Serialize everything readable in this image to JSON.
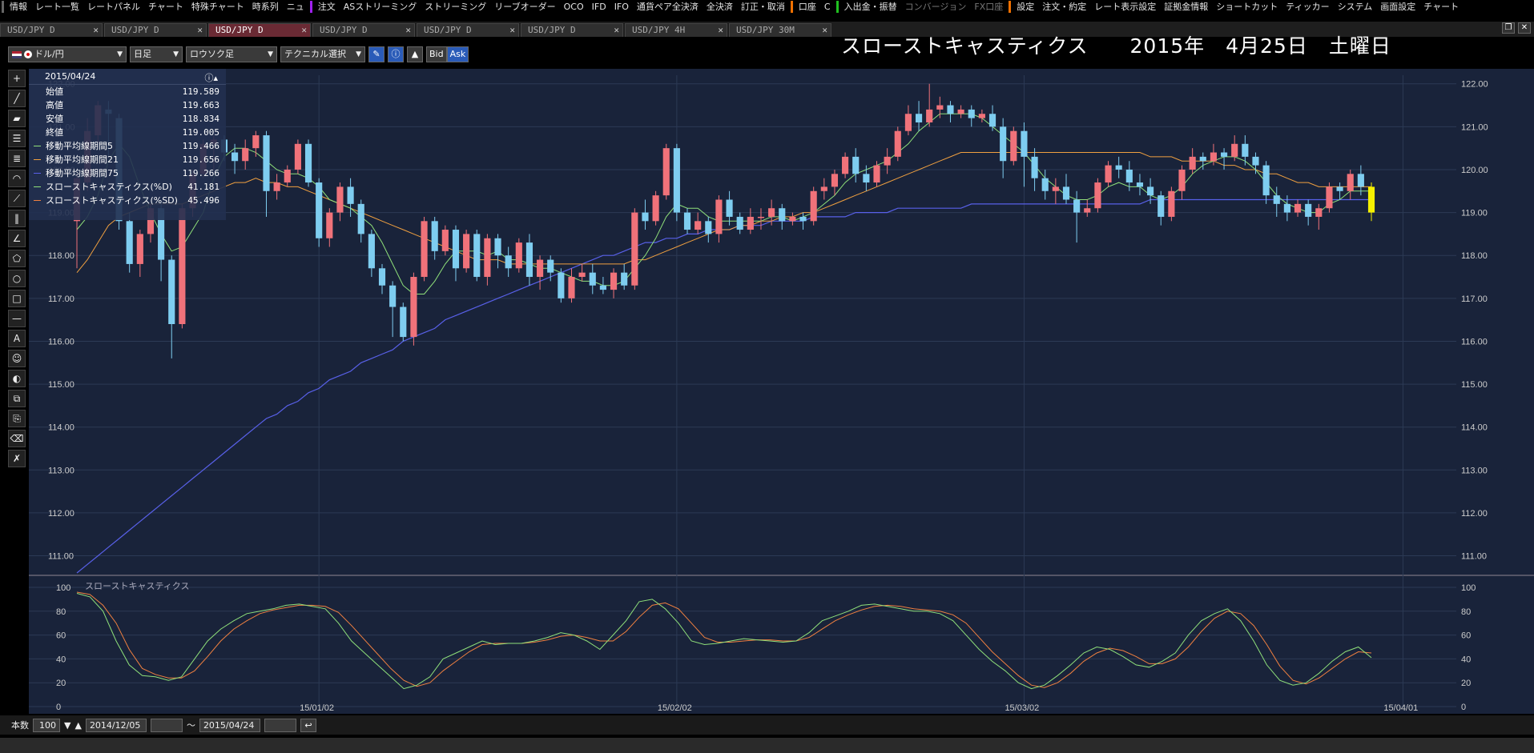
{
  "menubar": {
    "items": [
      "情報",
      "レート一覧",
      "レートパネル",
      "チャート",
      "特殊チャート",
      "時系列",
      "ニュ"
    ],
    "items2": [
      "注文",
      "ASストリーミング",
      "ストリーミング",
      "リーブオーダー",
      "OCO",
      "IFD",
      "IFO",
      "通貨ペア全決済",
      "全決済",
      "訂正・取消"
    ],
    "items3": [
      "口座",
      "C"
    ],
    "items4": [
      "入出金・振替"
    ],
    "items5": [
      "コンバージョン",
      "FX口座"
    ],
    "items6": [
      "設定",
      "注文・約定",
      "レート表示設定",
      "証拠金情報",
      "ショートカット",
      "ティッカー",
      "システム",
      "画面設定",
      "チャート"
    ]
  },
  "tabs": [
    {
      "label": "USD/JPY D",
      "active": false
    },
    {
      "label": "USD/JPY D",
      "active": false
    },
    {
      "label": "USD/JPY D",
      "active": true
    },
    {
      "label": "USD/JPY D",
      "active": false
    },
    {
      "label": "USD/JPY D",
      "active": false
    },
    {
      "label": "USD/JPY D",
      "active": false
    },
    {
      "label": "USD/JPY 4H",
      "active": false
    },
    {
      "label": "USD/JPY 30M",
      "active": false
    }
  ],
  "toolbar": {
    "pair": "ドル/円",
    "timeframe": "日足",
    "chart_type": "ロウソク足",
    "technical": "テクニカル選択",
    "bid": "Bid",
    "ask": "Ask"
  },
  "title": "スローストキャスティクス　　2015年　4月25日　土曜日",
  "info": {
    "date": "2015/04/24",
    "rows": [
      {
        "label": "始値",
        "value": "119.589"
      },
      {
        "label": "高値",
        "value": "119.663"
      },
      {
        "label": "安値",
        "value": "118.834"
      },
      {
        "label": "終値",
        "value": "119.005"
      },
      {
        "label": "移動平均線期間5",
        "value": "119.466"
      },
      {
        "label": "移動平均線期間21",
        "value": "119.656"
      },
      {
        "label": "移動平均線期間75",
        "value": "119.266"
      },
      {
        "label": "スローストキャスティクス(%D)",
        "value": "41.181"
      },
      {
        "label": "スローストキャスティクス(%SD)",
        "value": "45.496"
      }
    ]
  },
  "colors": {
    "up": "#f0727a",
    "down": "#7ecdf0",
    "ma5": "#8fe07a",
    "ma21": "#f0a040",
    "ma75": "#5860e8",
    "pct_d": "#8fe07a",
    "pct_sd": "#f08040",
    "last": "#f5f000"
  },
  "chart_data": {
    "type": "candlestick",
    "price_axis": {
      "ticks": [
        "122.00",
        "121.00",
        "120.00",
        "119.00",
        "118.00",
        "117.00",
        "116.00",
        "115.00",
        "114.00",
        "113.00",
        "112.00",
        "111.00"
      ],
      "ylim": [
        110.6,
        122.2
      ]
    },
    "date_labels": [
      "15/01/02",
      "15/02/02",
      "15/03/02",
      "15/04/01"
    ],
    "stoch_label": "スローストキャスティクス",
    "stoch_axis": {
      "ticks": [
        "100",
        "80",
        "60",
        "40",
        "20",
        "0"
      ],
      "ylim": [
        0,
        100
      ]
    },
    "candles": [
      [
        118.8,
        119.8,
        117.7,
        119.9
      ],
      [
        119.7,
        120.9,
        119.5,
        121.2
      ],
      [
        120.8,
        121.5,
        120.6,
        121.6
      ],
      [
        121.4,
        121.3,
        120.3,
        121.6
      ],
      [
        121.2,
        118.8,
        118.6,
        121.3
      ],
      [
        118.8,
        117.8,
        117.6,
        119.0
      ],
      [
        117.8,
        118.5,
        117.5,
        118.6
      ],
      [
        118.5,
        119.1,
        118.3,
        119.2
      ],
      [
        119.1,
        117.9,
        117.4,
        119.3
      ],
      [
        117.9,
        116.4,
        115.6,
        118.0
      ],
      [
        116.4,
        119.1,
        116.3,
        119.2
      ],
      [
        119.1,
        119.9,
        118.9,
        120.0
      ],
      [
        119.9,
        120.6,
        119.8,
        120.7
      ],
      [
        120.6,
        120.7,
        120.0,
        120.8
      ],
      [
        120.7,
        120.4,
        120.2,
        120.8
      ],
      [
        120.4,
        120.2,
        119.9,
        120.6
      ],
      [
        120.2,
        120.5,
        120.0,
        120.7
      ],
      [
        120.5,
        120.8,
        120.3,
        120.9
      ],
      [
        120.8,
        119.5,
        118.9,
        120.9
      ],
      [
        119.5,
        119.7,
        119.3,
        119.9
      ],
      [
        119.7,
        120.0,
        119.6,
        120.1
      ],
      [
        120.0,
        120.6,
        119.9,
        120.7
      ],
      [
        120.6,
        119.7,
        119.6,
        120.7
      ],
      [
        119.7,
        118.4,
        118.2,
        119.8
      ],
      [
        118.4,
        119.0,
        118.2,
        119.1
      ],
      [
        119.0,
        119.6,
        118.8,
        119.7
      ],
      [
        119.6,
        119.2,
        118.9,
        119.8
      ],
      [
        119.2,
        118.5,
        118.3,
        119.3
      ],
      [
        118.5,
        117.7,
        117.5,
        118.6
      ],
      [
        117.7,
        117.3,
        117.1,
        117.8
      ],
      [
        117.3,
        116.8,
        116.1,
        117.4
      ],
      [
        116.8,
        116.1,
        116.0,
        116.9
      ],
      [
        116.1,
        117.5,
        115.9,
        117.6
      ],
      [
        117.5,
        118.8,
        117.4,
        118.9
      ],
      [
        118.8,
        118.1,
        117.9,
        118.9
      ],
      [
        118.1,
        118.6,
        118.0,
        118.7
      ],
      [
        118.6,
        117.7,
        117.4,
        118.7
      ],
      [
        117.7,
        118.5,
        117.6,
        118.6
      ],
      [
        118.5,
        117.5,
        117.4,
        118.6
      ],
      [
        117.5,
        118.4,
        117.3,
        118.5
      ],
      [
        118.4,
        118.0,
        117.7,
        118.5
      ],
      [
        118.0,
        117.7,
        117.5,
        118.2
      ],
      [
        117.7,
        118.3,
        117.6,
        118.4
      ],
      [
        118.3,
        117.5,
        117.3,
        118.5
      ],
      [
        117.5,
        117.9,
        117.2,
        118.0
      ],
      [
        117.9,
        117.6,
        117.4,
        118.0
      ],
      [
        117.6,
        117.0,
        116.9,
        117.7
      ],
      [
        117.0,
        117.5,
        116.9,
        117.7
      ],
      [
        117.5,
        117.6,
        117.4,
        117.8
      ],
      [
        117.6,
        117.3,
        117.1,
        117.8
      ],
      [
        117.3,
        117.2,
        117.1,
        117.5
      ],
      [
        117.2,
        117.6,
        117.0,
        117.7
      ],
      [
        117.6,
        117.3,
        117.2,
        117.8
      ],
      [
        117.3,
        119.0,
        117.2,
        119.1
      ],
      [
        119.0,
        118.8,
        118.6,
        119.3
      ],
      [
        118.8,
        119.4,
        118.7,
        119.5
      ],
      [
        119.4,
        120.5,
        119.3,
        120.6
      ],
      [
        120.5,
        119.0,
        118.8,
        120.6
      ],
      [
        119.0,
        118.6,
        118.5,
        119.1
      ],
      [
        118.6,
        118.8,
        118.5,
        119.0
      ],
      [
        118.8,
        118.5,
        118.3,
        118.9
      ],
      [
        118.5,
        119.3,
        118.3,
        119.4
      ],
      [
        119.3,
        118.9,
        118.7,
        119.5
      ],
      [
        118.9,
        118.6,
        118.5,
        119.0
      ],
      [
        118.6,
        118.9,
        118.5,
        119.1
      ],
      [
        118.9,
        118.9,
        118.6,
        119.1
      ],
      [
        118.9,
        119.1,
        118.7,
        119.3
      ],
      [
        119.1,
        118.8,
        118.6,
        119.2
      ],
      [
        118.8,
        118.9,
        118.7,
        119.0
      ],
      [
        118.9,
        118.8,
        118.6,
        119.0
      ],
      [
        118.8,
        119.5,
        118.7,
        119.6
      ],
      [
        119.5,
        119.6,
        119.3,
        119.8
      ],
      [
        119.6,
        119.9,
        119.4,
        120.0
      ],
      [
        119.9,
        120.3,
        119.8,
        120.4
      ],
      [
        120.3,
        119.9,
        119.7,
        120.5
      ],
      [
        119.9,
        119.7,
        119.5,
        120.1
      ],
      [
        119.7,
        120.1,
        119.6,
        120.2
      ],
      [
        120.1,
        120.3,
        119.9,
        120.5
      ],
      [
        120.3,
        120.9,
        120.2,
        121.0
      ],
      [
        120.9,
        121.3,
        120.8,
        121.5
      ],
      [
        121.3,
        121.1,
        120.9,
        121.6
      ],
      [
        121.1,
        121.4,
        121.0,
        122.0
      ],
      [
        121.4,
        121.5,
        121.2,
        121.7
      ],
      [
        121.5,
        121.3,
        121.1,
        121.6
      ],
      [
        121.3,
        121.4,
        121.2,
        121.5
      ],
      [
        121.4,
        121.2,
        121.0,
        121.5
      ],
      [
        121.2,
        121.3,
        121.1,
        121.4
      ],
      [
        121.3,
        121.0,
        120.9,
        121.5
      ],
      [
        121.0,
        120.2,
        119.8,
        121.2
      ],
      [
        120.2,
        120.9,
        120.1,
        121.0
      ],
      [
        120.9,
        120.3,
        119.6,
        121.1
      ],
      [
        120.3,
        119.8,
        119.5,
        120.5
      ],
      [
        119.8,
        119.5,
        119.3,
        120.0
      ],
      [
        119.5,
        119.6,
        119.2,
        119.8
      ],
      [
        119.6,
        119.3,
        119.2,
        119.9
      ],
      [
        119.3,
        119.0,
        118.3,
        119.5
      ],
      [
        119.0,
        119.1,
        118.9,
        119.3
      ],
      [
        119.1,
        119.7,
        119.0,
        119.8
      ],
      [
        119.7,
        120.1,
        119.6,
        120.2
      ],
      [
        120.1,
        120.0,
        119.8,
        120.3
      ],
      [
        120.0,
        119.7,
        119.5,
        120.2
      ],
      [
        119.7,
        119.6,
        119.4,
        119.9
      ],
      [
        119.6,
        119.4,
        119.2,
        119.8
      ],
      [
        119.4,
        118.9,
        118.7,
        119.5
      ],
      [
        118.9,
        119.5,
        118.8,
        119.6
      ],
      [
        119.5,
        120.0,
        119.3,
        120.1
      ],
      [
        120.0,
        120.3,
        119.9,
        120.5
      ],
      [
        120.3,
        120.2,
        120.0,
        120.4
      ],
      [
        120.2,
        120.4,
        120.1,
        120.6
      ],
      [
        120.4,
        120.3,
        120.0,
        120.5
      ],
      [
        120.3,
        120.6,
        120.2,
        120.8
      ],
      [
        120.6,
        120.3,
        120.1,
        120.8
      ],
      [
        120.3,
        120.1,
        119.9,
        120.4
      ],
      [
        120.1,
        119.4,
        119.2,
        120.2
      ],
      [
        119.4,
        119.2,
        118.9,
        119.6
      ],
      [
        119.2,
        119.0,
        118.8,
        119.4
      ],
      [
        119.0,
        119.2,
        118.9,
        119.3
      ],
      [
        119.2,
        118.9,
        118.7,
        119.3
      ],
      [
        118.9,
        119.1,
        118.6,
        119.2
      ],
      [
        119.1,
        119.6,
        119.0,
        119.7
      ],
      [
        119.6,
        119.5,
        119.3,
        119.7
      ],
      [
        119.5,
        119.9,
        119.3,
        120.0
      ],
      [
        119.9,
        119.6,
        119.4,
        120.1
      ],
      [
        119.6,
        119.0,
        118.8,
        119.7
      ]
    ],
    "ma5": [
      118.6,
      118.9,
      119.4,
      120.2,
      120.6,
      120.3,
      119.6,
      119.0,
      118.5,
      118.1,
      118.2,
      118.6,
      119.0,
      119.8,
      120.3,
      120.5,
      120.5,
      120.4,
      120.2,
      120.0,
      119.9,
      119.9,
      119.8,
      119.6,
      119.3,
      119.2,
      119.1,
      118.9,
      118.7,
      118.3,
      117.8,
      117.3,
      117.1,
      117.1,
      117.4,
      117.8,
      118.1,
      118.1,
      118.1,
      118.0,
      118.1,
      117.9,
      117.9,
      117.8,
      117.7,
      117.7,
      117.6,
      117.5,
      117.4,
      117.4,
      117.3,
      117.3,
      117.4,
      117.7,
      118.0,
      118.4,
      118.9,
      119.2,
      119.1,
      119.1,
      118.9,
      118.8,
      118.8,
      118.8,
      118.8,
      118.8,
      118.9,
      118.9,
      118.8,
      118.9,
      119.0,
      119.2,
      119.4,
      119.7,
      119.9,
      120.0,
      120.1,
      120.2,
      120.4,
      120.6,
      120.9,
      121.1,
      121.3,
      121.3,
      121.3,
      121.3,
      121.2,
      121.0,
      120.8,
      120.6,
      120.4,
      120.1,
      119.8,
      119.6,
      119.4,
      119.3,
      119.3,
      119.4,
      119.6,
      119.7,
      119.6,
      119.6,
      119.4,
      119.3,
      119.4,
      119.6,
      119.9,
      120.1,
      120.2,
      120.3,
      120.3,
      120.2,
      120.0,
      119.7,
      119.4,
      119.2,
      119.1,
      119.0,
      119.0,
      119.2,
      119.3,
      119.5,
      119.5,
      119.5
    ],
    "ma21": [
      117.6,
      117.9,
      118.3,
      118.7,
      118.9,
      119.0,
      119.1,
      119.2,
      119.2,
      119.2,
      119.2,
      119.3,
      119.4,
      119.5,
      119.6,
      119.7,
      119.7,
      119.8,
      119.7,
      119.7,
      119.6,
      119.6,
      119.5,
      119.4,
      119.3,
      119.2,
      119.1,
      119.0,
      118.9,
      118.8,
      118.7,
      118.6,
      118.5,
      118.4,
      118.3,
      118.2,
      118.1,
      118.0,
      117.9,
      117.9,
      117.9,
      117.8,
      117.8,
      117.8,
      117.8,
      117.8,
      117.8,
      117.8,
      117.8,
      117.8,
      117.8,
      117.8,
      117.8,
      117.9,
      117.9,
      118.0,
      118.1,
      118.2,
      118.3,
      118.4,
      118.5,
      118.6,
      118.6,
      118.7,
      118.7,
      118.8,
      118.8,
      118.9,
      118.9,
      119.0,
      119.0,
      119.1,
      119.2,
      119.3,
      119.4,
      119.5,
      119.6,
      119.7,
      119.8,
      119.9,
      120.0,
      120.1,
      120.2,
      120.3,
      120.4,
      120.4,
      120.4,
      120.4,
      120.4,
      120.4,
      120.4,
      120.4,
      120.4,
      120.4,
      120.4,
      120.4,
      120.4,
      120.4,
      120.4,
      120.4,
      120.4,
      120.4,
      120.3,
      120.3,
      120.3,
      120.2,
      120.2,
      120.2,
      120.2,
      120.1,
      120.1,
      120.0,
      120.0,
      119.9,
      119.9,
      119.8,
      119.7,
      119.7,
      119.6,
      119.6,
      119.6,
      119.6,
      119.6,
      119.6
    ],
    "ma75": [
      110.6,
      110.8,
      111.0,
      111.2,
      111.4,
      111.6,
      111.8,
      112.0,
      112.2,
      112.4,
      112.6,
      112.8,
      113.0,
      113.2,
      113.4,
      113.6,
      113.8,
      114.0,
      114.2,
      114.3,
      114.5,
      114.6,
      114.8,
      114.9,
      115.1,
      115.2,
      115.3,
      115.5,
      115.6,
      115.7,
      115.8,
      116.0,
      116.1,
      116.2,
      116.3,
      116.5,
      116.6,
      116.7,
      116.8,
      116.9,
      117.0,
      117.1,
      117.2,
      117.3,
      117.4,
      117.5,
      117.6,
      117.7,
      117.8,
      117.9,
      118.0,
      118.0,
      118.1,
      118.2,
      118.3,
      118.3,
      118.4,
      118.4,
      118.5,
      118.5,
      118.6,
      118.6,
      118.6,
      118.7,
      118.7,
      118.7,
      118.8,
      118.8,
      118.8,
      118.8,
      118.9,
      118.9,
      118.9,
      118.9,
      119.0,
      119.0,
      119.0,
      119.0,
      119.1,
      119.1,
      119.1,
      119.1,
      119.1,
      119.1,
      119.1,
      119.2,
      119.2,
      119.2,
      119.2,
      119.2,
      119.2,
      119.2,
      119.2,
      119.2,
      119.2,
      119.2,
      119.2,
      119.2,
      119.2,
      119.2,
      119.2,
      119.2,
      119.3,
      119.3,
      119.3,
      119.3,
      119.3,
      119.3,
      119.3,
      119.3,
      119.3,
      119.3,
      119.3,
      119.3,
      119.3,
      119.3,
      119.3,
      119.3,
      119.3,
      119.3,
      119.3,
      119.3,
      119.3,
      119.3
    ],
    "pct_d": [
      95,
      92,
      80,
      55,
      35,
      26,
      25,
      22,
      25,
      40,
      55,
      65,
      72,
      78,
      80,
      82,
      85,
      86,
      84,
      82,
      70,
      55,
      45,
      35,
      25,
      15,
      18,
      25,
      40,
      45,
      50,
      55,
      52,
      53,
      53,
      55,
      58,
      62,
      60,
      55,
      48,
      60,
      72,
      88,
      90,
      82,
      70,
      55,
      52,
      53,
      55,
      57,
      56,
      55,
      54,
      55,
      62,
      72,
      76,
      80,
      85,
      86,
      84,
      82,
      80,
      80,
      78,
      72,
      60,
      48,
      38,
      30,
      20,
      15,
      18,
      26,
      35,
      45,
      50,
      48,
      42,
      35,
      33,
      38,
      45,
      60,
      72,
      78,
      82,
      72,
      55,
      35,
      22,
      18,
      20,
      28,
      38,
      46,
      50,
      41
    ],
    "pct_sd": [
      96,
      94,
      85,
      70,
      48,
      32,
      27,
      24,
      24,
      30,
      42,
      55,
      65,
      72,
      78,
      81,
      83,
      85,
      85,
      84,
      79,
      68,
      56,
      44,
      32,
      22,
      17,
      20,
      30,
      38,
      46,
      52,
      53,
      53,
      53,
      54,
      56,
      59,
      60,
      58,
      55,
      55,
      63,
      75,
      85,
      87,
      82,
      70,
      58,
      54,
      54,
      55,
      56,
      56,
      55,
      55,
      58,
      65,
      72,
      77,
      81,
      84,
      85,
      84,
      82,
      81,
      80,
      77,
      70,
      58,
      46,
      36,
      26,
      18,
      16,
      20,
      28,
      38,
      45,
      49,
      47,
      42,
      36,
      36,
      40,
      50,
      63,
      74,
      80,
      78,
      68,
      52,
      34,
      22,
      19,
      24,
      32,
      40,
      46,
      45
    ]
  },
  "bottom": {
    "count_label": "本数",
    "count_value": "100",
    "start_date": "2014/12/05",
    "tilde": "〜",
    "end_date": "2015/04/24"
  }
}
